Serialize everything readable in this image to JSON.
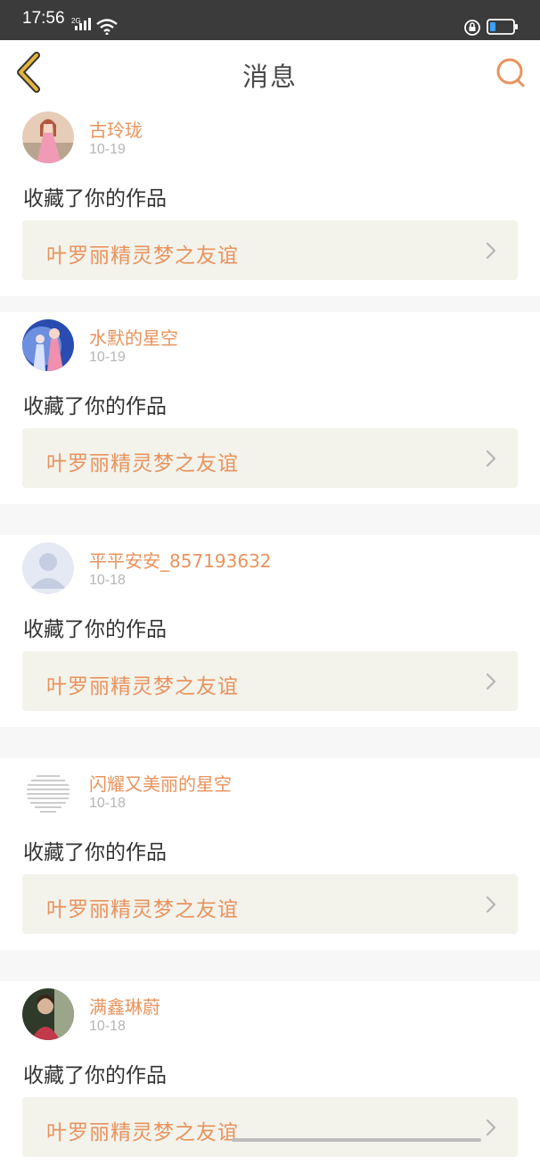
{
  "status_bar": {
    "time": "17:56",
    "network": "2G"
  },
  "header": {
    "title": "消息"
  },
  "theme": {
    "accent": "#e8935d",
    "back_icon_color": "#e5b53c"
  },
  "messages": [
    {
      "name": "古玲珑",
      "date": "10-19",
      "action": "收藏了你的作品",
      "work": "叶罗丽精灵梦之友谊"
    },
    {
      "name": "水默的星空",
      "date": "10-19",
      "action": "收藏了你的作品",
      "work": "叶罗丽精灵梦之友谊"
    },
    {
      "name": "平平安安_857193632",
      "date": "10-18",
      "action": "收藏了你的作品",
      "work": "叶罗丽精灵梦之友谊"
    },
    {
      "name": "闪耀又美丽的星空",
      "date": "10-18",
      "action": "收藏了你的作品",
      "work": "叶罗丽精灵梦之友谊"
    },
    {
      "name": "满鑫琳蔚",
      "date": "10-18",
      "action": "收藏了你的作品",
      "work": "叶罗丽精灵梦之友谊"
    }
  ]
}
